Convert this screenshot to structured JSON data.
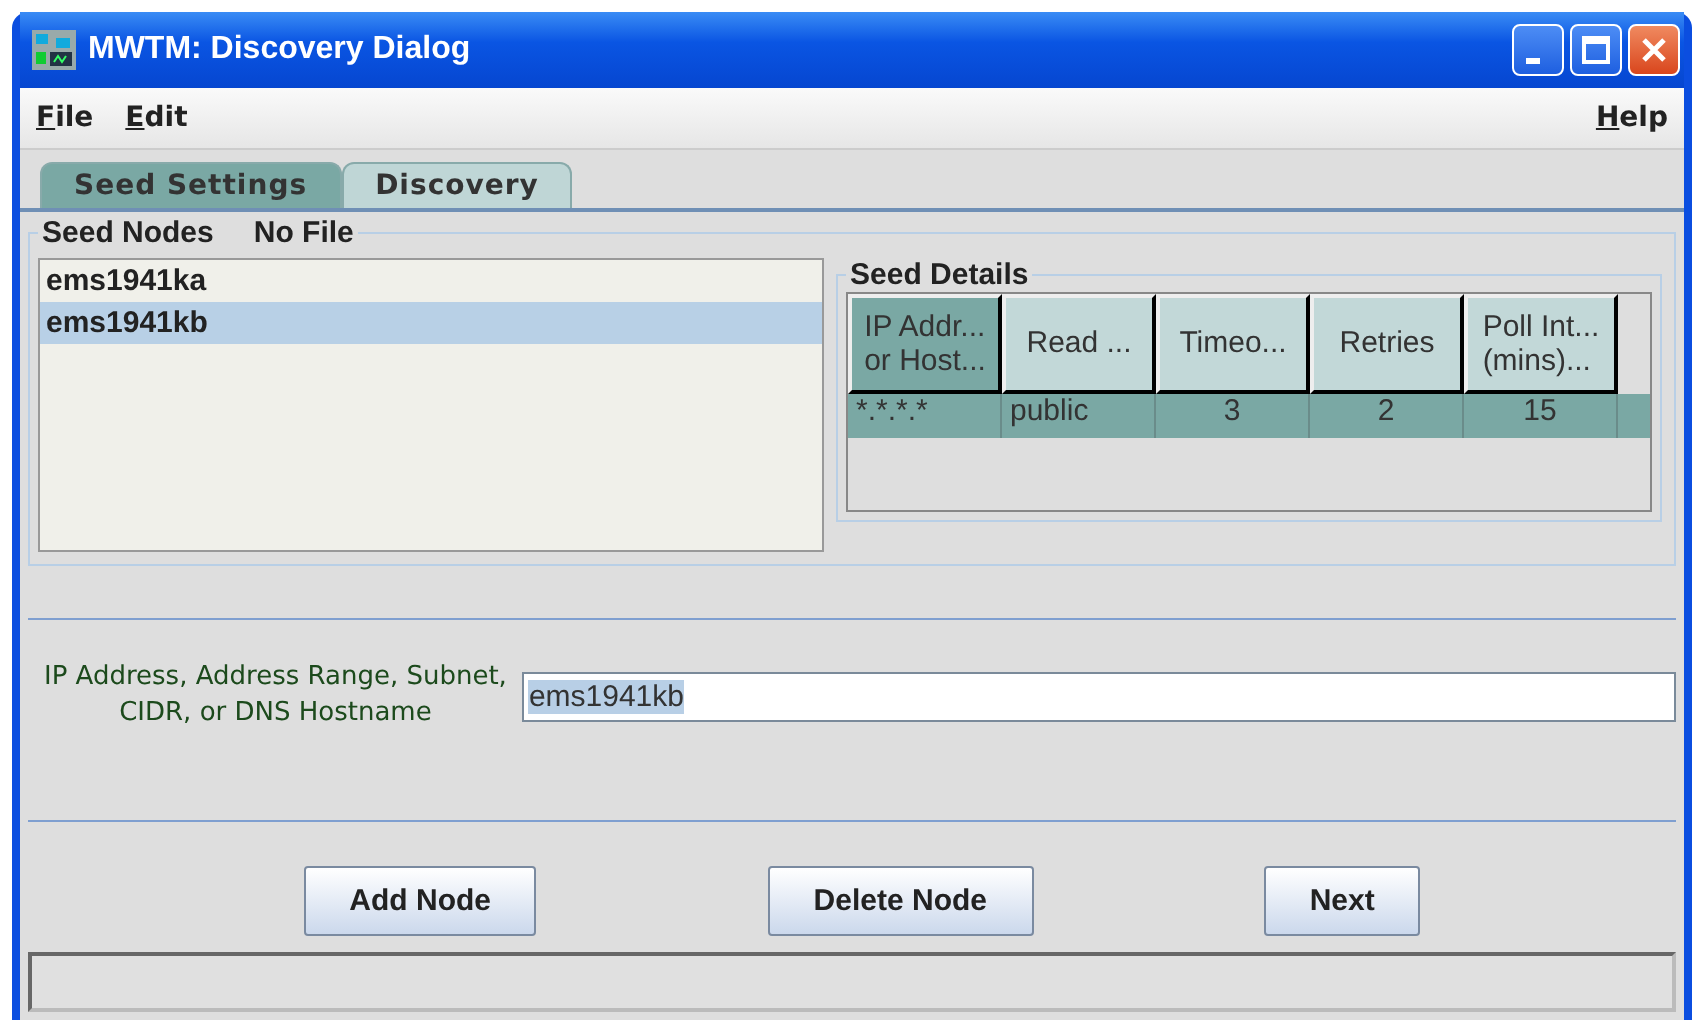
{
  "window": {
    "title": "MWTM: Discovery Dialog"
  },
  "menu": [
    {
      "label": "File"
    },
    {
      "label": "Edit"
    },
    {
      "label": "Help"
    }
  ],
  "tabs": [
    {
      "label": "Seed Settings",
      "selected": true
    },
    {
      "label": "Discovery",
      "selected": false
    }
  ],
  "seed_nodes": {
    "title": "Seed Nodes",
    "file": "No File",
    "items": [
      {
        "label": "ems1941ka",
        "selected": false
      },
      {
        "label": "ems1941kb",
        "selected": true
      }
    ]
  },
  "seed_details": {
    "title": "Seed Details",
    "columns": [
      {
        "label": "IP Addr...\nor Host...",
        "selected": true
      },
      {
        "label": "Read ...",
        "selected": false
      },
      {
        "label": "Timeo...",
        "selected": false
      },
      {
        "label": "Retries",
        "selected": false
      },
      {
        "label": "Poll Int...\n(mins)...",
        "selected": false
      }
    ],
    "rows": [
      {
        "cells": [
          "*.*.*.*",
          "public",
          "3",
          "2",
          "15"
        ],
        "selected": true
      }
    ]
  },
  "address": {
    "label": "IP Address, Address Range, Subnet,\nCIDR, or DNS Hostname",
    "value": "ems1941kb",
    "value_selected": true
  },
  "buttons": [
    "Add Node",
    "Delete Node",
    "Next"
  ]
}
